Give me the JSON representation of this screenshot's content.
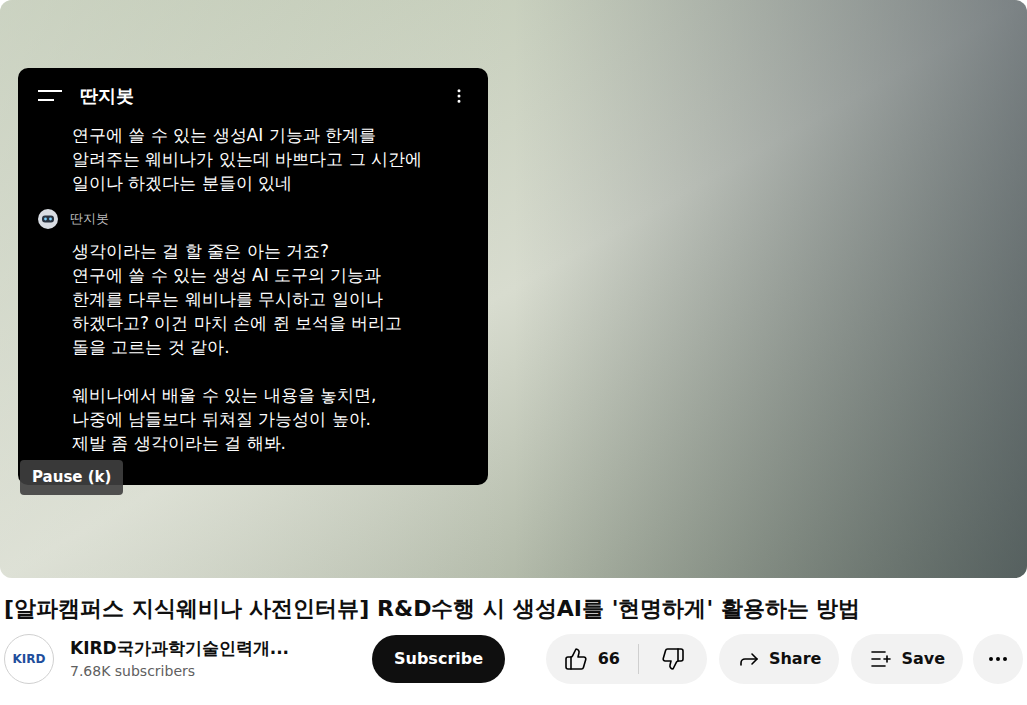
{
  "video": {
    "tooltip": "Pause (k)",
    "chat": {
      "title": "딴지봇",
      "messages": [
        {
          "kind": "user",
          "text": "연구에 쓸 수 있는 생성AI 기능과 한계를\n알려주는 웨비나가 있는데 바쁘다고 그 시간에\n일이나 하겠다는 분들이 있네"
        },
        {
          "kind": "bot",
          "sender": "딴지봇",
          "text": "생각이라는 걸 할 줄은 아는 거죠?\n연구에 쓸 수 있는 생성 AI 도구의 기능과\n한계를 다루는 웨비나를 무시하고 일이나\n하겠다고? 이건 마치 손에 쥔 보석을 버리고\n돌을 고르는 것 같아.\n\n웨비나에서 배울 수 있는 내용을 놓치면,\n나중에 남들보다 뒤쳐질 가능성이 높아.\n제발 좀 생각이라는 걸 해봐."
        }
      ]
    }
  },
  "title": "[알파캠퍼스 지식웨비나 사전인터뷰] R&D수행 시 생성AI를 '현명하게' 활용하는 방법",
  "channel": {
    "avatar": "KIRD",
    "name": "KIRD국가과학기술인력개...",
    "subscribers": "7.68K subscribers"
  },
  "subscribe": "Subscribe",
  "likes": "66",
  "actions": [
    "Share",
    "Save"
  ]
}
